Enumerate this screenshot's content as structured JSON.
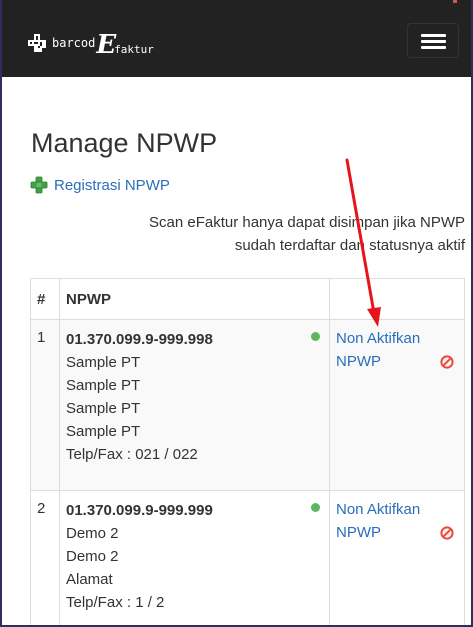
{
  "app": {
    "brand_barcode": "barcod",
    "brand_e": "E",
    "brand_faktur": "faktur"
  },
  "page": {
    "title": "Manage NPWP",
    "register_link": "Registrasi NPWP",
    "info_line1": "Scan eFaktur hanya dapat disimpan jika NPWP",
    "info_line2": "sudah terdaftar dan statusnya aktif"
  },
  "table": {
    "headers": [
      "#",
      "NPWP",
      ""
    ],
    "rows": [
      {
        "num": "1",
        "npwp": "01.370.099.9-999.998",
        "lines": [
          "Sample PT",
          "Sample PT",
          "Sample PT",
          "Sample PT",
          "Telp/Fax : 021 / 022"
        ],
        "action_1": "Non Aktifkan",
        "action_2": "NPWP"
      },
      {
        "num": "2",
        "npwp": "01.370.099.9-999.999",
        "lines": [
          "Demo 2",
          "Demo 2",
          "Alamat",
          "Telp/Fax : 1 / 2"
        ],
        "action_1": "Non Aktifkan",
        "action_2": "NPWP"
      }
    ]
  },
  "colors": {
    "navbar": "#222222",
    "link": "#2a6ebb",
    "status_active": "#5cb85c",
    "annotation_arrow": "#e8141b",
    "ban_icon": "#e84c3d"
  },
  "icons": [
    "qr-code-icon",
    "hamburger-menu-icon",
    "green-plus-icon",
    "status-active-dot-icon",
    "ban-icon"
  ]
}
